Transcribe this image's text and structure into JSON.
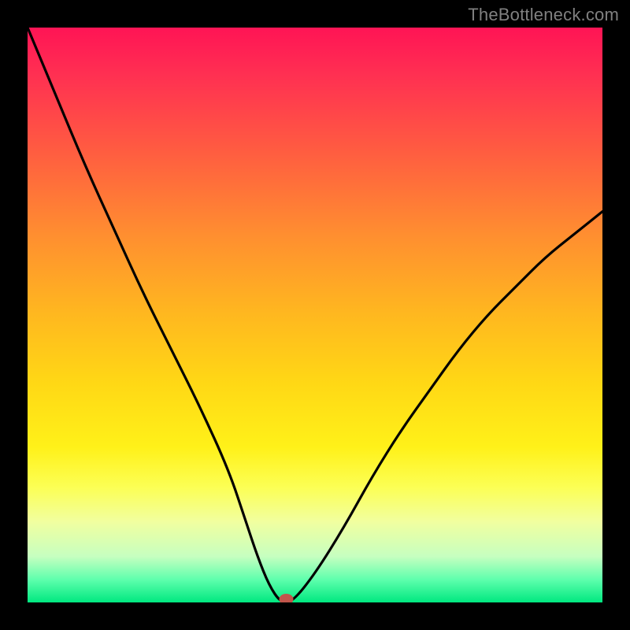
{
  "watermark": "TheBottleneck.com",
  "chart_data": {
    "type": "line",
    "title": "",
    "xlabel": "",
    "ylabel": "",
    "xlim": [
      0,
      100
    ],
    "ylim": [
      0,
      100
    ],
    "grid": false,
    "legend": false,
    "series": [
      {
        "name": "bottleneck-curve",
        "x": [
          0,
          5,
          10,
          15,
          20,
          25,
          30,
          35,
          38,
          40,
          42,
          44,
          46,
          50,
          55,
          60,
          65,
          70,
          75,
          80,
          85,
          90,
          95,
          100
        ],
        "values": [
          100,
          88,
          76,
          65,
          54,
          44,
          34,
          23,
          14,
          8,
          3,
          0,
          0,
          5,
          13,
          22,
          30,
          37,
          44,
          50,
          55,
          60,
          64,
          68
        ]
      }
    ],
    "marker": {
      "x": 45,
      "y": 0,
      "color": "#c1554b"
    },
    "background_gradient": {
      "type": "vertical",
      "stops": [
        {
          "pos": 0.0,
          "color": "#ff1455"
        },
        {
          "pos": 0.5,
          "color": "#ffb81f"
        },
        {
          "pos": 0.8,
          "color": "#fcff55"
        },
        {
          "pos": 1.0,
          "color": "#00e880"
        }
      ]
    }
  }
}
